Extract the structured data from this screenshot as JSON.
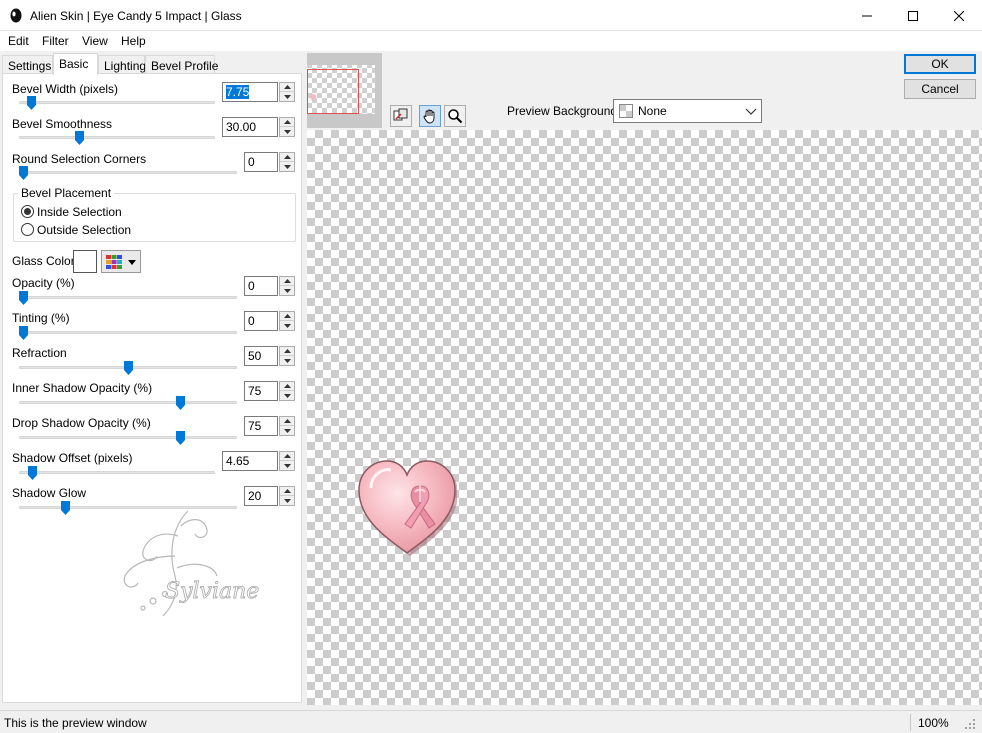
{
  "window": {
    "title": "Alien Skin | Eye Candy 5 Impact | Glass"
  },
  "menu": [
    "Edit",
    "Filter",
    "View",
    "Help"
  ],
  "tabs": [
    "Settings",
    "Basic",
    "Lighting",
    "Bevel Profile"
  ],
  "active_tab": "Basic",
  "controls": {
    "bevel_width": {
      "label": "Bevel Width (pixels)",
      "value": "7.75"
    },
    "bevel_smoothness": {
      "label": "Bevel Smoothness",
      "value": "30.00"
    },
    "round_corners": {
      "label": "Round Selection Corners",
      "value": "0"
    },
    "opacity": {
      "label": "Opacity (%)",
      "value": "0"
    },
    "tinting": {
      "label": "Tinting (%)",
      "value": "0"
    },
    "refraction": {
      "label": "Refraction",
      "value": "50"
    },
    "inner_shadow": {
      "label": "Inner Shadow Opacity (%)",
      "value": "75"
    },
    "drop_shadow": {
      "label": "Drop Shadow Opacity (%)",
      "value": "75"
    },
    "shadow_offset": {
      "label": "Shadow Offset (pixels)",
      "value": "4.65"
    },
    "shadow_glow": {
      "label": "Shadow Glow",
      "value": "20"
    }
  },
  "bevel_placement": {
    "label": "Bevel Placement",
    "inside": "Inside Selection",
    "outside": "Outside Selection",
    "selected": "inside"
  },
  "glass_color": {
    "label": "Glass Color",
    "value": "#ffffff"
  },
  "watermark": {
    "text": "Sylviane"
  },
  "preview_background": {
    "label": "Preview Background:",
    "value": "None"
  },
  "buttons": {
    "ok": "OK",
    "cancel": "Cancel"
  },
  "status": {
    "text": "This is the preview window",
    "zoom": "100%"
  },
  "colors": {
    "accent": "#0078d7",
    "heart": "#f6b8c0",
    "ribbon": "#e98fa3",
    "frame": "#e05050"
  }
}
